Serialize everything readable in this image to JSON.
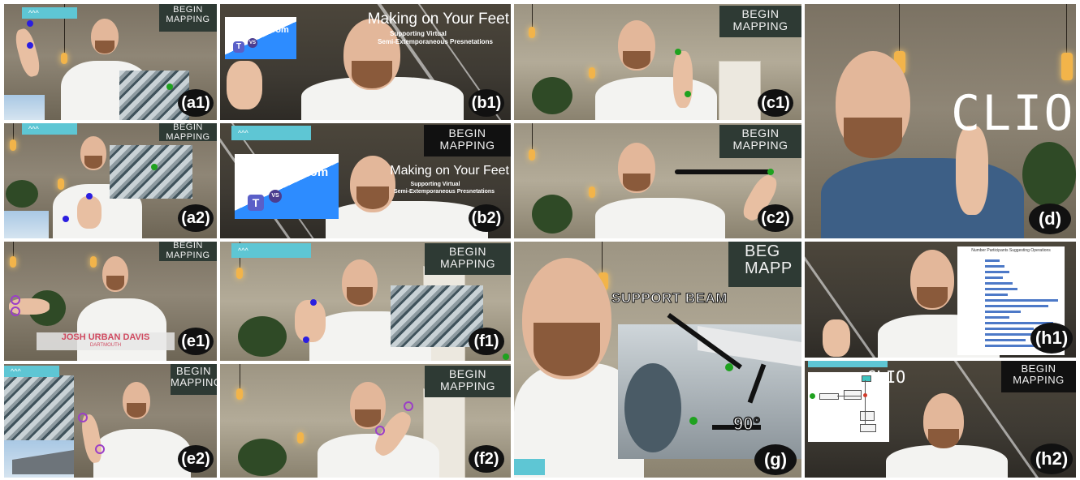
{
  "overlay": {
    "begin_line1": "BEGIN",
    "begin_line2": "MAPPING",
    "begin_g_line1": "BEG",
    "begin_g_line2": "MAPP",
    "teal_glyph": "^^^",
    "zoom_logo": "zoom",
    "vs": "VS",
    "teams_letter": "T",
    "talk_title": "Making on Your Feet",
    "talk_sub1": "Supporting Virtual",
    "talk_sub2": "Semi-Extemporaneous Presnetations",
    "clio": "CLIO",
    "name_lower_third": "JOSH URBAN DAVIS",
    "name_sub": "DARTMOUTH",
    "support_beam": "SUPPORT BEAM",
    "angle": "90°",
    "chart_title": "Number Participants Suggesting Operations"
  },
  "labels": {
    "a1": "(a1)",
    "a2": "(a2)",
    "b1": "(b1)",
    "b2": "(b2)",
    "c1": "(c1)",
    "c2": "(c2)",
    "d": "(d)",
    "e1": "(e1)",
    "e2": "(e2)",
    "f1": "(f1)",
    "f2": "(f2)",
    "g": "(g)",
    "h1": "(h1)",
    "h2": "(h2)"
  },
  "colors": {
    "marker_blue": "#2b1ee0",
    "marker_green": "#1fa21f",
    "marker_purple": "#9b3fc7",
    "teal": "#5ec6d4",
    "zoom_blue": "#2d8cff",
    "label_bg": "#111111"
  }
}
